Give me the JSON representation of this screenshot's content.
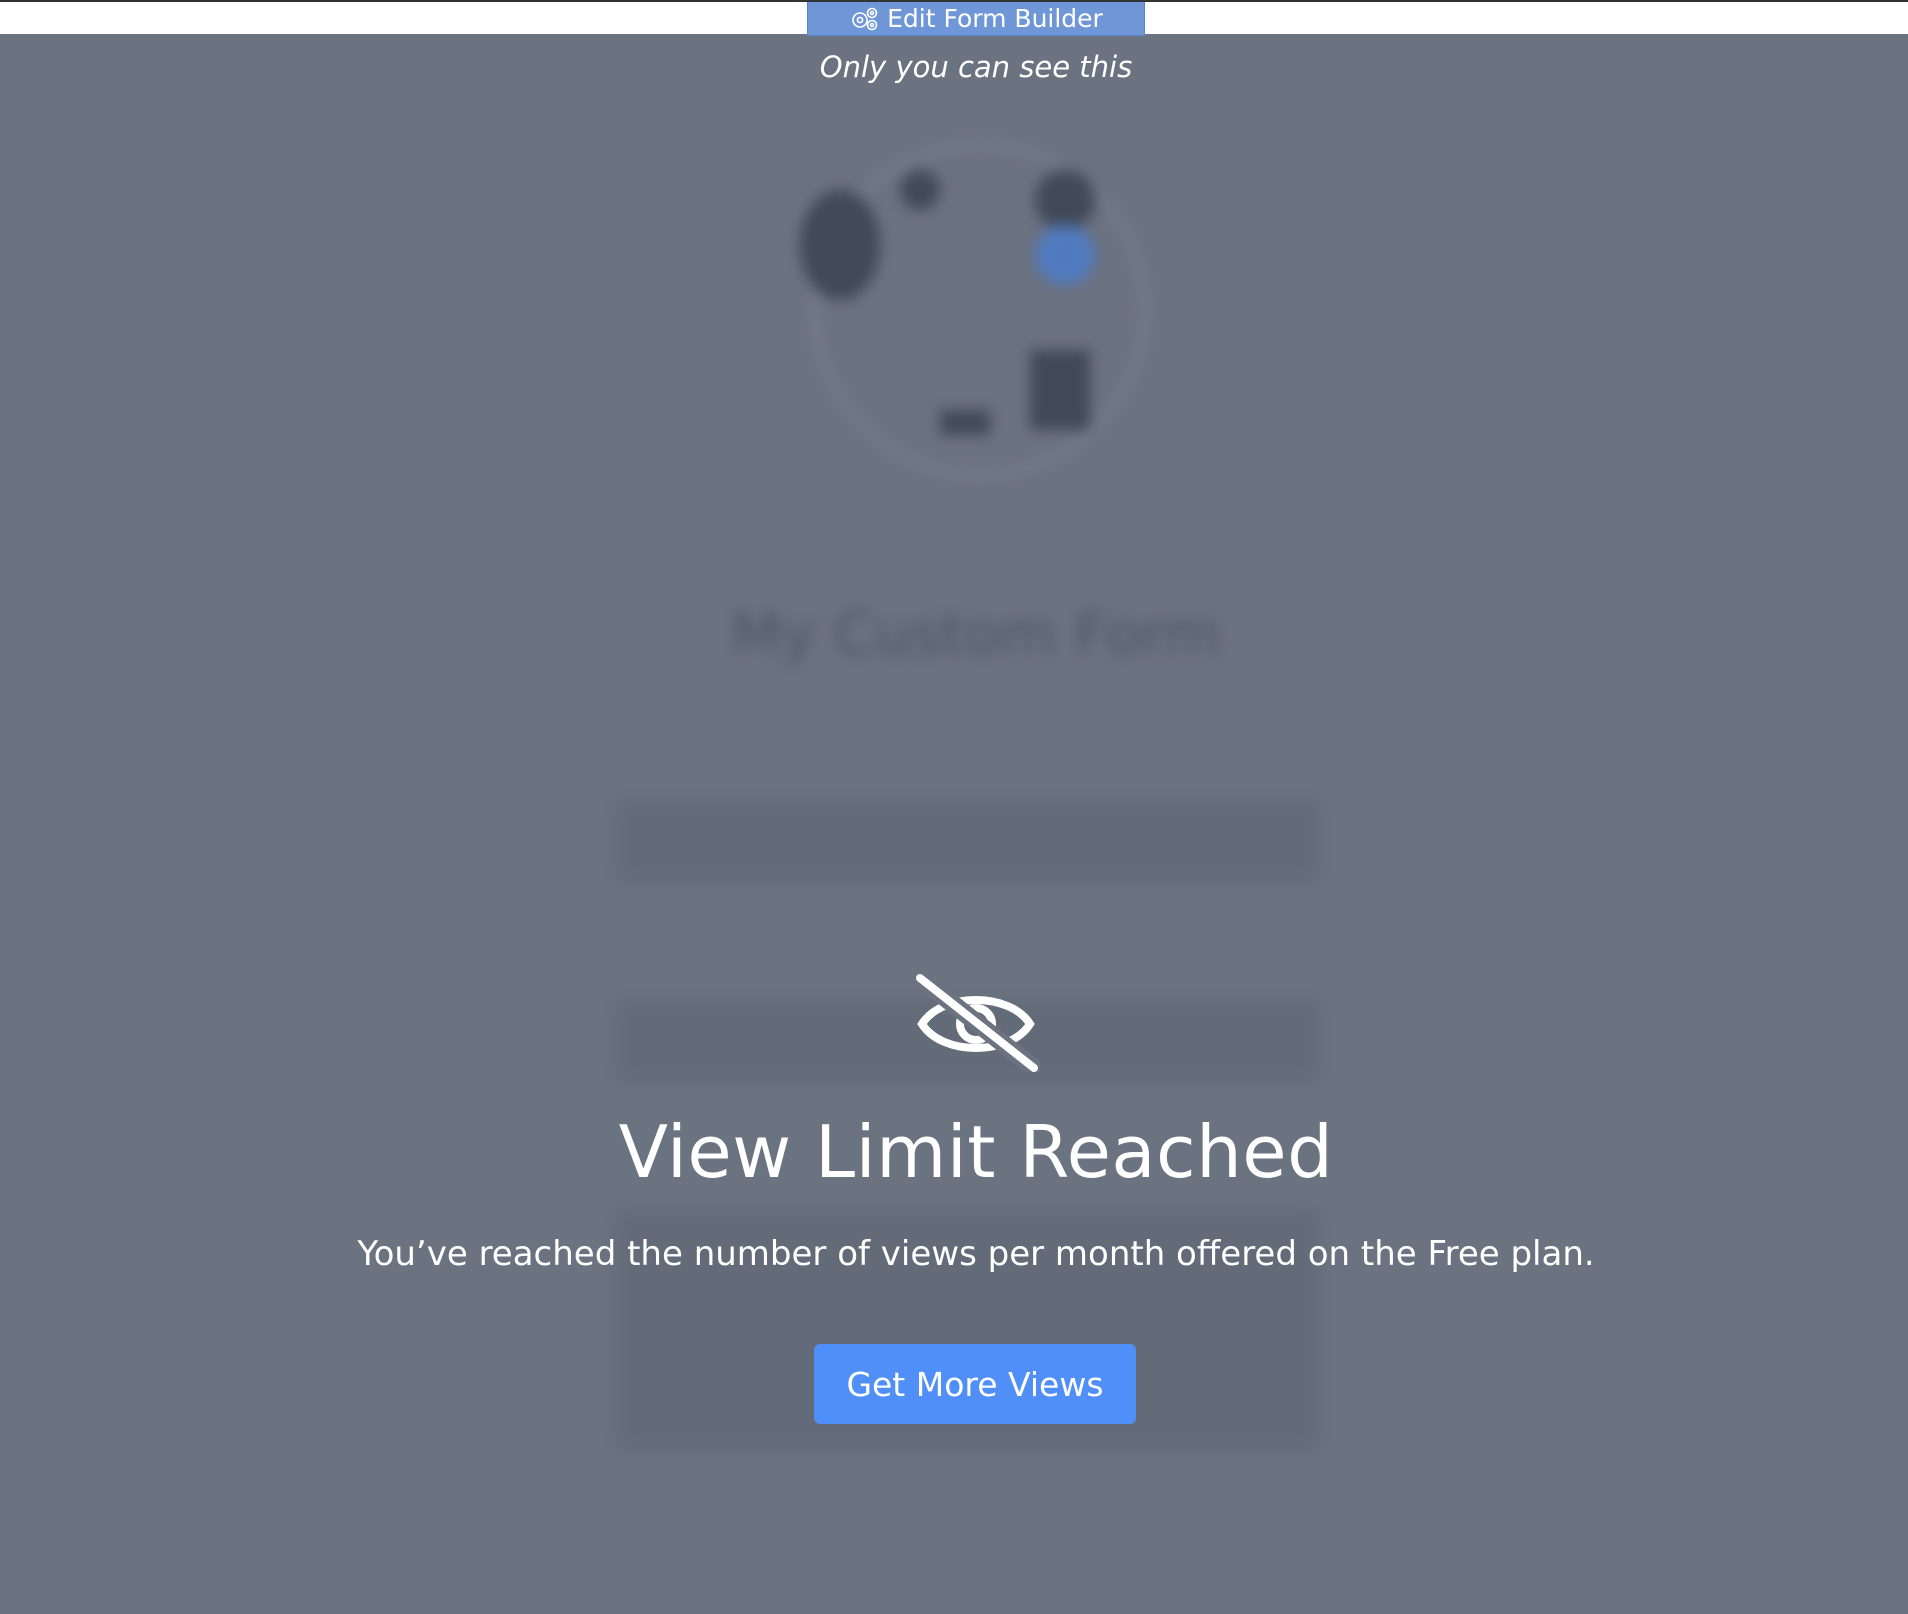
{
  "topbar": {
    "edit_button_label": "Edit Form Builder",
    "visibility_note": "Only you can see this"
  },
  "background_form": {
    "title": "My Custom Form"
  },
  "overlay": {
    "title": "View Limit Reached",
    "message": "You’ve reached the number of views per month offered on the Free plan.",
    "cta_label": "Get More Views"
  },
  "colors": {
    "overlay_bg": "#6b7280",
    "edit_button_bg": "#6f97d8",
    "cta_bg": "#4f8ff7",
    "text": "#ffffff"
  },
  "icons": {
    "edit_button": "gears-icon",
    "overlay": "eye-slash-icon"
  }
}
